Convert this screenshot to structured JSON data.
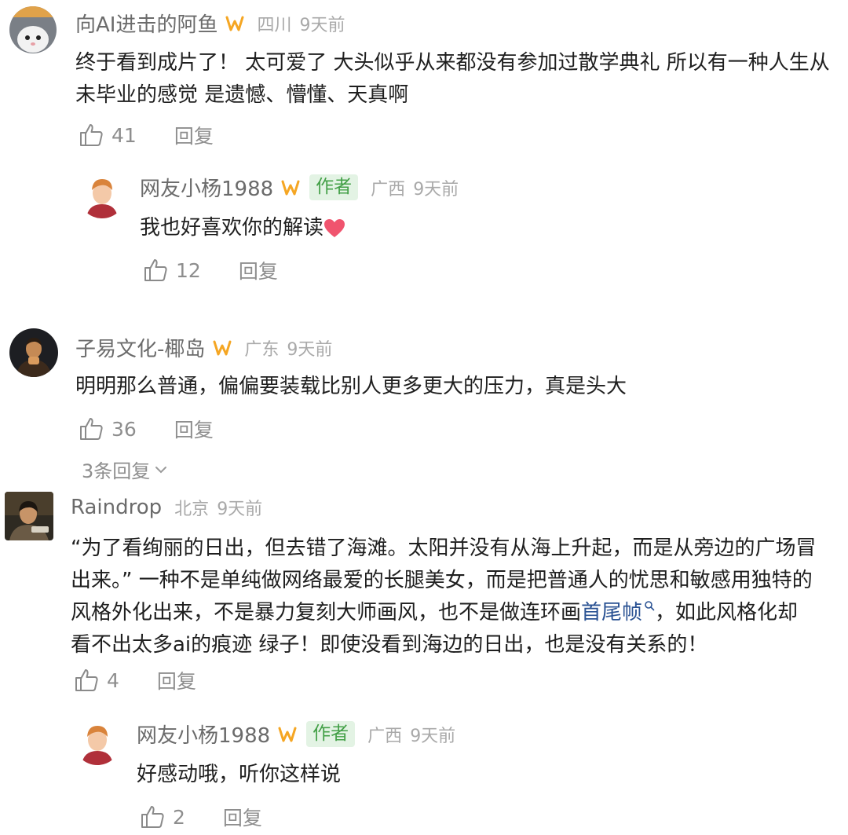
{
  "colors": {
    "author_tag_bg": "#e3f3e4",
    "author_tag_text": "#43a047",
    "badge": "#f5a623",
    "link": "#2a5293"
  },
  "c1": {
    "name": "向AI进击的阿鱼",
    "location": "四川",
    "time": "9天前",
    "line1": "终于看到成片了！ 太可爱了 大头似乎从来都没有参加过散学典礼 所以有一种人生从",
    "line2": "未毕业的感觉 是遗憾、懵懂、天真啊",
    "likes": "41",
    "reply_label": "回复"
  },
  "r1": {
    "name": "网友小杨1988",
    "tag": "作者",
    "location": "广西",
    "time": "9天前",
    "text": "我也好喜欢你的解读",
    "emoji": "heart-emoji",
    "likes": "12",
    "reply_label": "回复"
  },
  "c2": {
    "name": "子易文化-椰岛",
    "location": "广东",
    "time": "9天前",
    "text": "明明那么普通，偏偏要装载比别人更多更大的压力，真是头大",
    "likes": "36",
    "reply_label": "回复",
    "more_replies": "3条回复"
  },
  "c3": {
    "name": "Raindrop",
    "location": "北京",
    "time": "9天前",
    "line1": "“为了看绚丽的日出，但去错了海滩。太阳并没有从海上升起，而是从旁边的广场冒",
    "line2": "出来。” 一种不是单纯做网络最爱的长腿美女，而是把普通人的忧思和敏感用独特的",
    "line3_a": "风格外化出来，不是暴力复刻大师画风，也不是做连环画",
    "line3_link": "首尾帧",
    "line3_b": "，如此风格化却",
    "line4": "看不出太多ai的痕迹 绿子！即使没看到海边的日出，也是没有关系的！",
    "likes": "4",
    "reply_label": "回复"
  },
  "r2": {
    "name": "网友小杨1988",
    "tag": "作者",
    "location": "广西",
    "time": "9天前",
    "text": "好感动哦，听你这样说",
    "likes": "2",
    "reply_label": "回复"
  }
}
